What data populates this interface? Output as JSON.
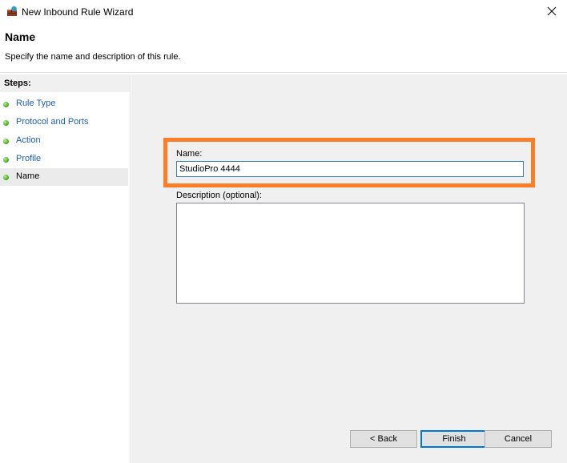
{
  "window": {
    "title": "New Inbound Rule Wizard",
    "icon": "firewall-icon",
    "close_icon": "close-icon"
  },
  "header": {
    "title": "Name",
    "subtitle": "Specify the name and description of this rule."
  },
  "steps": {
    "heading": "Steps:",
    "items": [
      {
        "label": "Rule Type",
        "current": false
      },
      {
        "label": "Protocol and Ports",
        "current": false
      },
      {
        "label": "Action",
        "current": false
      },
      {
        "label": "Profile",
        "current": false
      },
      {
        "label": "Name",
        "current": true
      }
    ]
  },
  "form": {
    "name_label": "Name:",
    "name_value": "StudioPro 4444",
    "description_label": "Description (optional):",
    "description_value": ""
  },
  "buttons": {
    "back": "< Back",
    "finish": "Finish",
    "cancel": "Cancel"
  },
  "colors": {
    "highlight": "#fb7d26",
    "link": "#1a5fb4",
    "focus_border": "#0078d7"
  }
}
